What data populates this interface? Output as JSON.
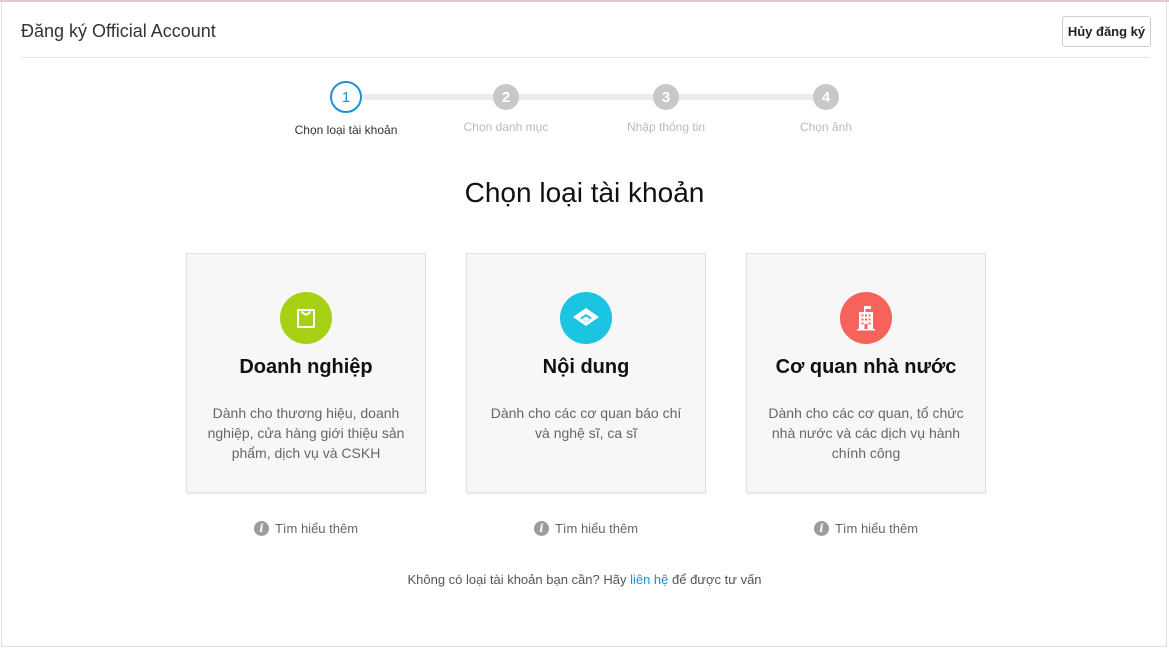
{
  "header": {
    "title": "Đăng ký Official Account",
    "cancel_label": "Hủy đăng ký"
  },
  "stepper": {
    "steps": [
      {
        "number": "1",
        "label": "Chọn loại tài khoản",
        "state": "active"
      },
      {
        "number": "2",
        "label": "Chọn danh mục",
        "state": "inactive"
      },
      {
        "number": "3",
        "label": "Nhập thông tin",
        "state": "inactive"
      },
      {
        "number": "4",
        "label": "Chọn ảnh",
        "state": "inactive"
      }
    ],
    "active_color": "#1e8fd8",
    "inactive_color": "#c8c8c8"
  },
  "main": {
    "title": "Chọn loại tài khoản"
  },
  "cards": [
    {
      "title": "Doanh nghiệp",
      "description": "Dành cho thương hiệu, doanh nghiệp, cửa hàng giới thiệu sản phẩm, dịch vụ và CSKH",
      "icon": "shopping-bag-icon",
      "icon_color": "#a6d014",
      "learn_more": "Tìm hiểu thêm"
    },
    {
      "title": "Nội dung",
      "description": "Dành cho các cơ quan báo chí và nghệ sĩ, ca sĩ",
      "icon": "content-icon",
      "icon_color": "#1bc4e0",
      "learn_more": "Tìm hiểu thêm"
    },
    {
      "title": "Cơ quan nhà nước",
      "description": "Dành cho các cơ quan, tổ chức nhà nước và các dịch vụ hành chính công",
      "icon": "government-building-icon",
      "icon_color": "#f5635a",
      "learn_more": "Tìm hiểu thêm"
    }
  ],
  "footer": {
    "text_before": "Không có loại tài khoản bạn cần? Hãy ",
    "link_label": "liên hệ",
    "text_after": " để được tư vấn"
  }
}
